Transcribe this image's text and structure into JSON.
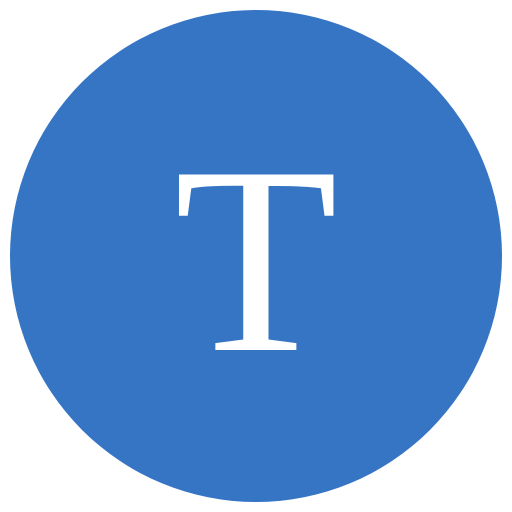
{
  "avatar": {
    "letter": "T",
    "background_color": "#3674C4",
    "text_color": "#FFFFFF"
  }
}
